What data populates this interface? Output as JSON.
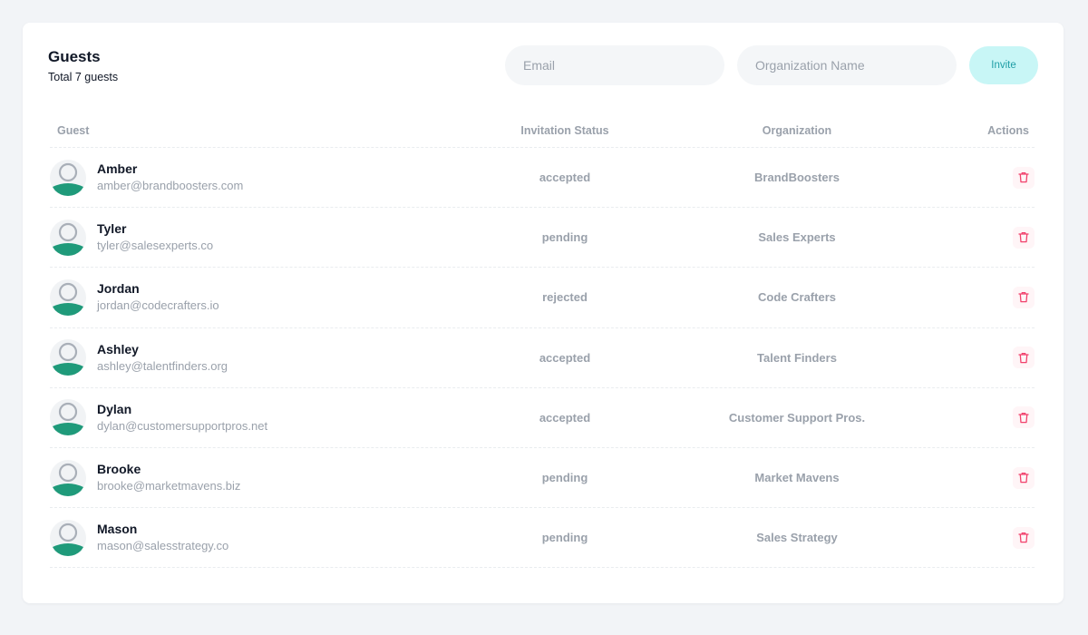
{
  "header": {
    "title": "Guests",
    "subtitle": "Total 7 guests",
    "email_placeholder": "Email",
    "org_placeholder": "Organization Name",
    "invite_label": "Invite"
  },
  "table": {
    "columns": {
      "guest": "Guest",
      "status": "Invitation Status",
      "organization": "Organization",
      "actions": "Actions"
    },
    "rows": [
      {
        "name": "Amber",
        "email": "amber@brandboosters.com",
        "status": "accepted",
        "organization": "BrandBoosters"
      },
      {
        "name": "Tyler",
        "email": "tyler@salesexperts.co",
        "status": "pending",
        "organization": "Sales Experts"
      },
      {
        "name": "Jordan",
        "email": "jordan@codecrafters.io",
        "status": "rejected",
        "organization": "Code Crafters"
      },
      {
        "name": "Ashley",
        "email": "ashley@talentfinders.org",
        "status": "accepted",
        "organization": "Talent Finders"
      },
      {
        "name": "Dylan",
        "email": "dylan@customersupportpros.net",
        "status": "accepted",
        "organization": "Customer Support Pros."
      },
      {
        "name": "Brooke",
        "email": "brooke@marketmavens.biz",
        "status": "pending",
        "organization": "Market Mavens"
      },
      {
        "name": "Mason",
        "email": "mason@salesstrategy.co",
        "status": "pending",
        "organization": "Sales Strategy"
      }
    ]
  },
  "icons": {
    "avatar": "user-avatar-icon",
    "delete": "trash-icon"
  },
  "colors": {
    "accent": "#1f9ea6",
    "invite_bg": "#c8f6f6",
    "avatar_body": "#1f9a7a",
    "delete_icon": "#f1416c"
  }
}
